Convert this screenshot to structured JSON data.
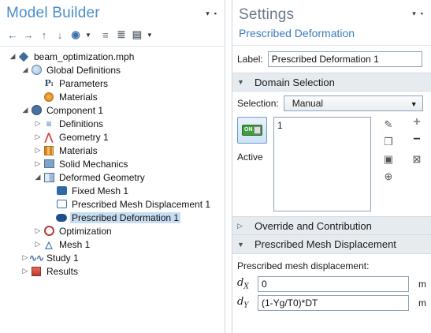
{
  "model_builder": {
    "title": "Model Builder",
    "tree": [
      {
        "label": "beam_optimization.mph",
        "level": 0,
        "twisty": "open"
      },
      {
        "label": "Global Definitions",
        "level": 1,
        "twisty": "open"
      },
      {
        "label": "Parameters",
        "level": 2,
        "twisty": "none"
      },
      {
        "label": "Materials",
        "level": 2,
        "twisty": "none"
      },
      {
        "label": "Component 1",
        "level": 1,
        "twisty": "open"
      },
      {
        "label": "Definitions",
        "level": 2,
        "twisty": "closed"
      },
      {
        "label": "Geometry 1",
        "level": 2,
        "twisty": "closed"
      },
      {
        "label": "Materials",
        "level": 2,
        "twisty": "closed"
      },
      {
        "label": "Solid Mechanics",
        "level": 2,
        "twisty": "closed"
      },
      {
        "label": "Deformed Geometry",
        "level": 2,
        "twisty": "open"
      },
      {
        "label": "Fixed Mesh 1",
        "level": 3,
        "twisty": "none"
      },
      {
        "label": "Prescribed Mesh Displacement 1",
        "level": 3,
        "twisty": "none"
      },
      {
        "label": "Prescribed Deformation 1",
        "level": 3,
        "twisty": "none",
        "selected": true
      },
      {
        "label": "Optimization",
        "level": 2,
        "twisty": "closed"
      },
      {
        "label": "Mesh 1",
        "level": 2,
        "twisty": "closed"
      },
      {
        "label": "Study 1",
        "level": 1,
        "twisty": "closed"
      },
      {
        "label": "Results",
        "level": 1,
        "twisty": "closed"
      }
    ]
  },
  "settings": {
    "title": "Settings",
    "subtitle": "Prescribed Deformation",
    "label_key": "Label:",
    "label_value": "Prescribed Deformation 1",
    "domain_selection": {
      "header": "Domain Selection",
      "selection_key": "Selection:",
      "selection_value": "Manual",
      "active_label": "Active",
      "switch_text": "ON",
      "list_items": [
        "1"
      ]
    },
    "override_header": "Override and Contribution",
    "pmd_header": "Prescribed Mesh Displacement",
    "pmd_label": "Prescribed mesh displacement:",
    "dx": {
      "symbol": "d",
      "sub": "X",
      "value": "0",
      "unit": "m"
    },
    "dy": {
      "symbol": "d",
      "sub": "Y",
      "value": "(1-Yg/T0)*DT",
      "unit": "m"
    }
  }
}
